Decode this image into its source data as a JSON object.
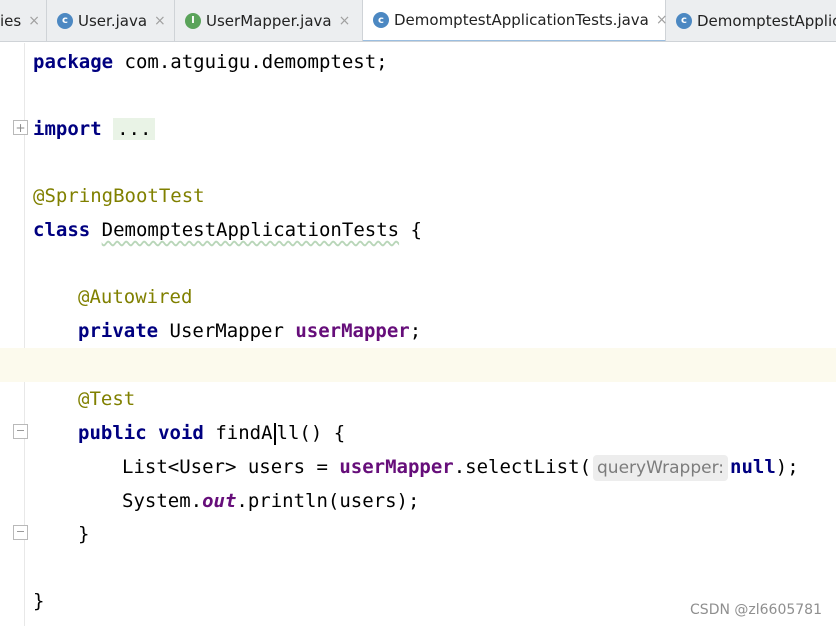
{
  "tabs": [
    {
      "label": "ies",
      "icon": "properties-icon",
      "icon_letter": "",
      "icon_color": "#9aa3ab"
    },
    {
      "label": "User.java",
      "icon": "class-icon",
      "icon_letter": "c",
      "icon_color": "#4c88c2"
    },
    {
      "label": "UserMapper.java",
      "icon": "interface-icon",
      "icon_letter": "I",
      "icon_color": "#5aa35a"
    },
    {
      "label": "DemomptestApplicationTests.java",
      "icon": "test-class-icon",
      "icon_letter": "c",
      "icon_color": "#4c88c2"
    },
    {
      "label": "DemomptestApplic",
      "icon": "spring-class-icon",
      "icon_letter": "c",
      "icon_color": "#4c88c2"
    }
  ],
  "close_glyph": "×",
  "code": {
    "package_kw": "package",
    "package_name": " com.atguigu.demomptest;",
    "import_kw": "import",
    "import_fold": "...",
    "springboot_ann": "@SpringBootTest",
    "class_kw": "class",
    "class_name": "DemomptestApplicationTests",
    "class_open": " {",
    "autowired_ann": "@Autowired",
    "private_kw": "private",
    "usermapper_type": " UserMapper ",
    "usermapper_field": "userMapper",
    "semicolon": ";",
    "test_ann": "@Test",
    "public_kw": "public",
    "void_kw": "void",
    "method_name_a": "findA",
    "method_name_b": "ll() {",
    "list_decl": "List<User> users = ",
    "usermapper_ref": "userMapper",
    "select_call": ".selectList(",
    "param_hint": "queryWrapper:",
    "null_kw": "null",
    "call_end": ");",
    "system": "System.",
    "out": "out",
    "println": ".println(users);",
    "method_close": "}",
    "class_close": "}"
  },
  "watermark": "CSDN @zl6605781"
}
